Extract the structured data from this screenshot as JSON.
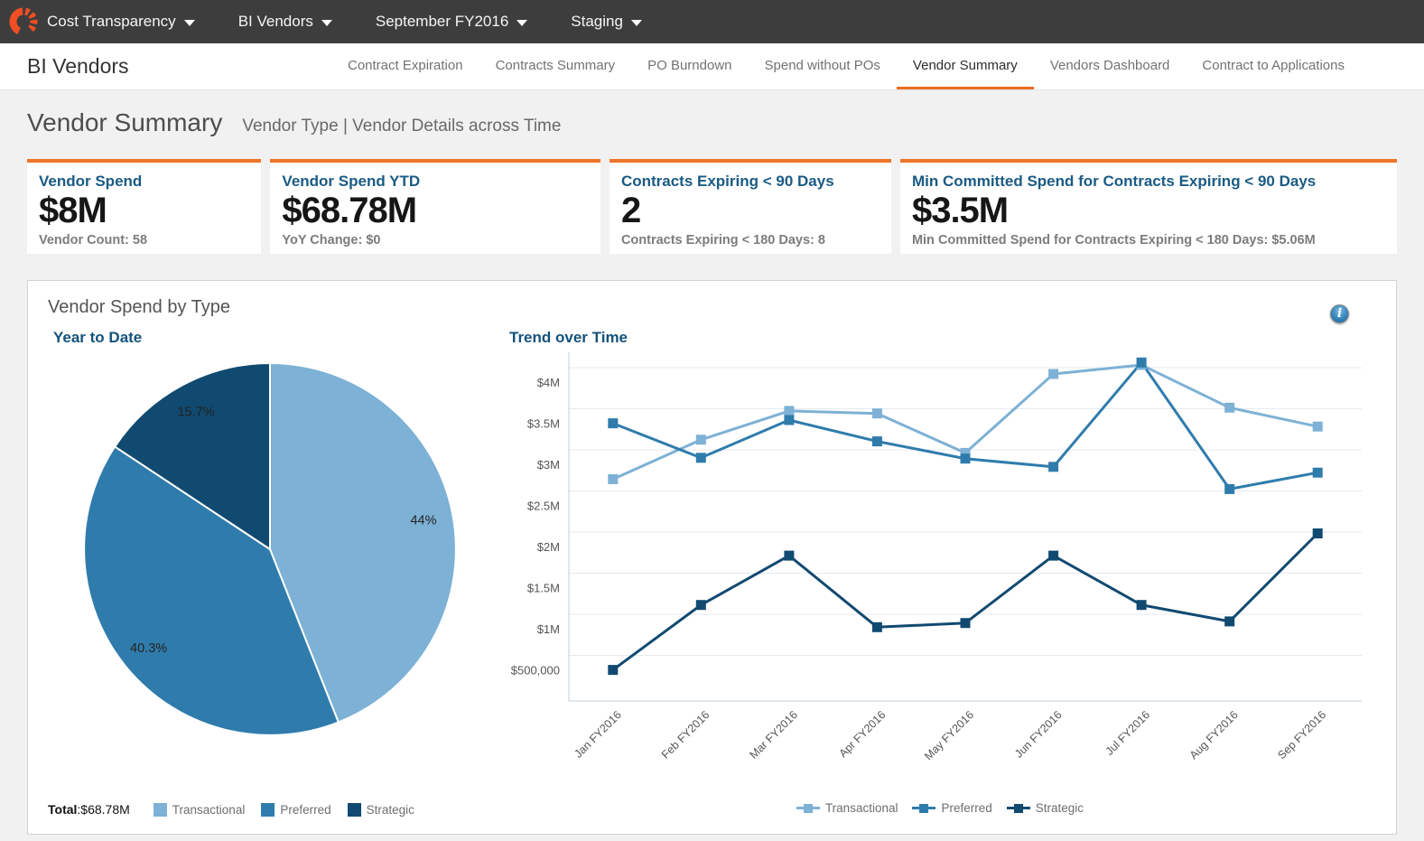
{
  "topnav": {
    "items": [
      {
        "label": "Cost Transparency"
      },
      {
        "label": "BI Vendors"
      },
      {
        "label": "September FY2016"
      },
      {
        "label": "Staging"
      }
    ]
  },
  "header": {
    "title": "BI Vendors",
    "tabs": [
      {
        "label": "Contract Expiration",
        "active": false
      },
      {
        "label": "Contracts Summary",
        "active": false
      },
      {
        "label": "PO Burndown",
        "active": false
      },
      {
        "label": "Spend without POs",
        "active": false
      },
      {
        "label": "Vendor Summary",
        "active": true
      },
      {
        "label": "Vendors Dashboard",
        "active": false
      },
      {
        "label": "Contract to Applications",
        "active": false
      }
    ]
  },
  "page": {
    "title": "Vendor Summary",
    "subtitle": "Vendor Type | Vendor Details across Time"
  },
  "kpis": [
    {
      "title": "Vendor Spend",
      "value": "$8M",
      "subtitle": "Vendor Count: 58"
    },
    {
      "title": "Vendor Spend YTD",
      "value": "$68.78M",
      "subtitle": "YoY Change: $0"
    },
    {
      "title": "Contracts Expiring < 90 Days",
      "value": "2",
      "subtitle": "Contracts Expiring < 180 Days: 8"
    },
    {
      "title": "Min Committed Spend for Contracts Expiring < 90 Days",
      "value": "$3.5M",
      "subtitle": "Min Committed Spend for Contracts Expiring < 180 Days: $5.06M"
    }
  ],
  "panel": {
    "title": "Vendor Spend by Type"
  },
  "icons": {
    "info": "info-icon",
    "dropdown": "caret-down-icon",
    "logo": "apptio-logo"
  },
  "colors": {
    "accent_orange": "#ED7428",
    "logo_orange": "#F04E23",
    "title_blue": "#1A5B84",
    "transactional": "#7DB1D5",
    "preferred": "#2F7CAC",
    "strategic": "#114A70",
    "gridline": "#E4EAF0",
    "axis": "#C2CDD8"
  },
  "chart_data": [
    {
      "type": "pie",
      "title": "Year to Date",
      "labels": [
        "Transactional",
        "Preferred",
        "Strategic"
      ],
      "values_percent": [
        44,
        40.3,
        15.7
      ],
      "slice_labels": [
        "44%",
        "40.3%",
        "15.7%"
      ],
      "colors": [
        "#7DB1D5",
        "#2F7CAC",
        "#114A70"
      ],
      "start_angle_deg": 0,
      "direction": "clockwise",
      "legend_position": "bottom",
      "total_label": "Total",
      "total_colon": ":",
      "total_value": "$68.78M"
    },
    {
      "type": "line",
      "title": "Trend over Time",
      "categories": [
        "Jan FY2016",
        "Feb FY2016",
        "Mar FY2016",
        "Apr FY2016",
        "May FY2016",
        "Jun FY2016",
        "Jul FY2016",
        "Aug FY2016",
        "Sep FY2016"
      ],
      "series": [
        {
          "name": "Transactional",
          "color": "#7DB1D5",
          "values": [
            2.83,
            3.31,
            3.66,
            3.63,
            3.15,
            4.11,
            4.22,
            3.7,
            3.47
          ]
        },
        {
          "name": "Preferred",
          "color": "#2F7CAC",
          "values": [
            3.51,
            3.09,
            3.55,
            3.29,
            3.08,
            2.98,
            4.25,
            2.71,
            2.91
          ]
        },
        {
          "name": "Strategic",
          "color": "#114A70",
          "values": [
            0.51,
            1.3,
            1.9,
            1.03,
            1.08,
            1.9,
            1.3,
            1.1,
            2.17
          ]
        }
      ],
      "unit": "USD millions",
      "y_ticks": [
        {
          "label": "$4M",
          "value": 4
        },
        {
          "label": "$3.5M",
          "value": 3.5
        },
        {
          "label": "$3M",
          "value": 3
        },
        {
          "label": "$2.5M",
          "value": 2.5
        },
        {
          "label": "$2M",
          "value": 2
        },
        {
          "label": "$1.5M",
          "value": 1.5
        },
        {
          "label": "$1M",
          "value": 1
        },
        {
          "label": "$500,000",
          "value": 0.5
        }
      ],
      "ylim": [
        0.13,
        4.29
      ],
      "grid": true,
      "marker": "square",
      "legend_position": "bottom"
    }
  ]
}
